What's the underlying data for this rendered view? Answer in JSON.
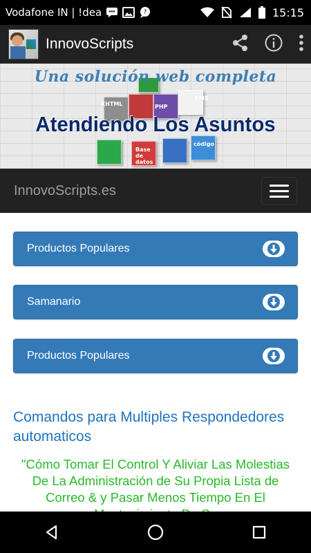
{
  "status_bar": {
    "carrier": "Vodafone IN | !dea",
    "time": "15:15",
    "icons": [
      "message-icon",
      "image-icon",
      "chat-icon",
      "wifi-icon",
      "no-sim-icon",
      "signal-icon",
      "battery-icon"
    ]
  },
  "app_bar": {
    "title": "InnovoScripts",
    "actions": [
      "share-icon",
      "info-icon",
      "overflow-menu-icon"
    ]
  },
  "banner": {
    "subtitle": "Una solución web completa",
    "headline": "Atendiendo Los Asuntos",
    "cube_labels": [
      "PHP",
      "CMS",
      "XHTML",
      "código",
      "Base de datos"
    ]
  },
  "navbar": {
    "brand": "InnovoScripts.es"
  },
  "accordion": [
    {
      "label": "Productos Populares"
    },
    {
      "label": "Samanario"
    },
    {
      "label": "Productos Populares"
    }
  ],
  "content": {
    "heading": "Comandos para Multiples Respondedores automaticos",
    "quote": "\"Cómo Tomar El Control Y Aliviar Las Molestias De La Administración de Su Propia Lista de Correo & y Pasar Menos Tiempo En El Mantenimiento De Su"
  },
  "colors": {
    "panel": "#337ab7",
    "heading": "#1e73be",
    "quote": "#28b928",
    "navbar": "#222222"
  }
}
